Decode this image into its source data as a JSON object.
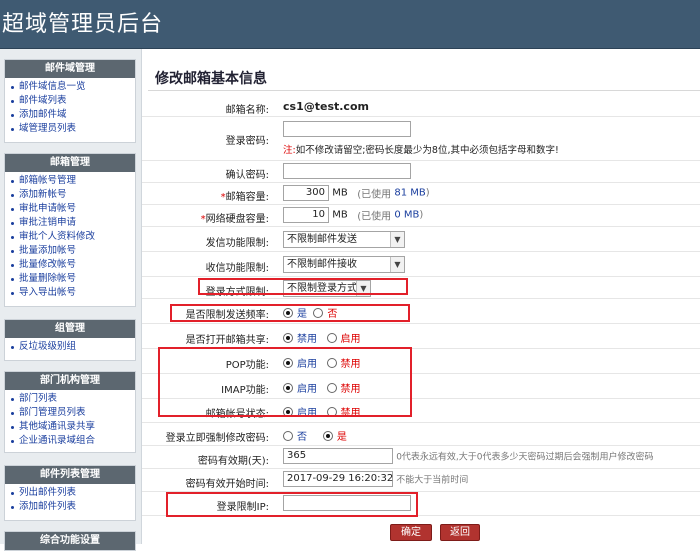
{
  "header": {
    "title": "超域管理员后台"
  },
  "sidebar": {
    "mail_domain": {
      "heading": "邮件域管理",
      "items": [
        "邮件域信息一览",
        "邮件域列表",
        "添加邮件域",
        "域管理员列表"
      ]
    },
    "mailbox": {
      "heading": "邮箱管理",
      "items": [
        "邮箱帐号管理",
        "添加新帐号",
        "审批申请帐号",
        "审批注销申请",
        "审批个人资料修改",
        "批量添加帐号",
        "批量修改帐号",
        "批量删除帐号",
        "导入导出帐号"
      ]
    },
    "group": {
      "heading": "组管理",
      "items": [
        "反垃圾级别组"
      ]
    },
    "dept": {
      "heading": "部门机构管理",
      "items": [
        "部门列表",
        "部门管理员列表",
        "其他域通讯录共享",
        "企业通讯录域组合"
      ]
    },
    "mlist": {
      "heading": "邮件列表管理",
      "items": [
        "列出邮件列表",
        "添加邮件列表"
      ]
    },
    "misc": {
      "heading": "综合功能设置"
    }
  },
  "form": {
    "title": "修改邮箱基本信息",
    "account": {
      "label": "邮箱名称:",
      "value": "cs1@test.com"
    },
    "password": {
      "label": "登录密码:",
      "note_prefix": "注:",
      "note": "如不修改请留空;密码长度最少为8位,其中必须包括字母和数字!"
    },
    "confirm": {
      "label": "确认密码:"
    },
    "capacity": {
      "star": "*",
      "label": "邮箱容量:",
      "value": "300",
      "unit": "MB",
      "used_prefix": "(已使用",
      "used": "81 MB",
      "used_suffix": ")"
    },
    "netdisk": {
      "star": "*",
      "label": "网络硬盘容量:",
      "value": "10",
      "unit": "MB",
      "used_prefix": "(已使用",
      "used": "0 MB",
      "used_suffix": ")"
    },
    "send_limit": {
      "label": "发信功能限制:",
      "value": "不限制邮件发送"
    },
    "recv_limit": {
      "label": "收信功能限制:",
      "value": "不限制邮件接收"
    },
    "login_limit": {
      "label": "登录方式限制:",
      "value": "不限制登录方式"
    },
    "freq_limit": {
      "label": "是否限制发送频率:",
      "yes": "是",
      "no": "否"
    },
    "netdisk_share": {
      "label": "是否打开邮箱共享:",
      "off": "禁用",
      "on": "启用"
    },
    "pop": {
      "label": "POP功能:",
      "on": "启用",
      "off": "禁用"
    },
    "imap": {
      "label": "IMAP功能:",
      "on": "启用",
      "off": "禁用"
    },
    "status": {
      "label": "邮箱帐号状态:",
      "on": "启用",
      "off": "禁用"
    },
    "force_pwd": {
      "label": "登录立即强制修改密码:",
      "no": "否",
      "yes": "是"
    },
    "pwd_valid": {
      "label": "密码有效期(天):",
      "value": "365",
      "hint": "0代表永远有效,大于0代表多少天密码过期后会强制用户修改密码"
    },
    "pwd_start": {
      "label": "密码有效开始时间:",
      "value": "2017-09-29 16:20:32",
      "hint": "不能大于当前时间"
    },
    "ip_limit": {
      "label": "登录限制IP:"
    },
    "buttons": {
      "ok": "确定",
      "back": "返回"
    }
  },
  "colors": {
    "header_bg": "#3f5a72",
    "sidebar_heading_bg": "#5c6770",
    "link": "#1a3e9e",
    "highlight": "#e2202a",
    "button": "#b1332f"
  }
}
